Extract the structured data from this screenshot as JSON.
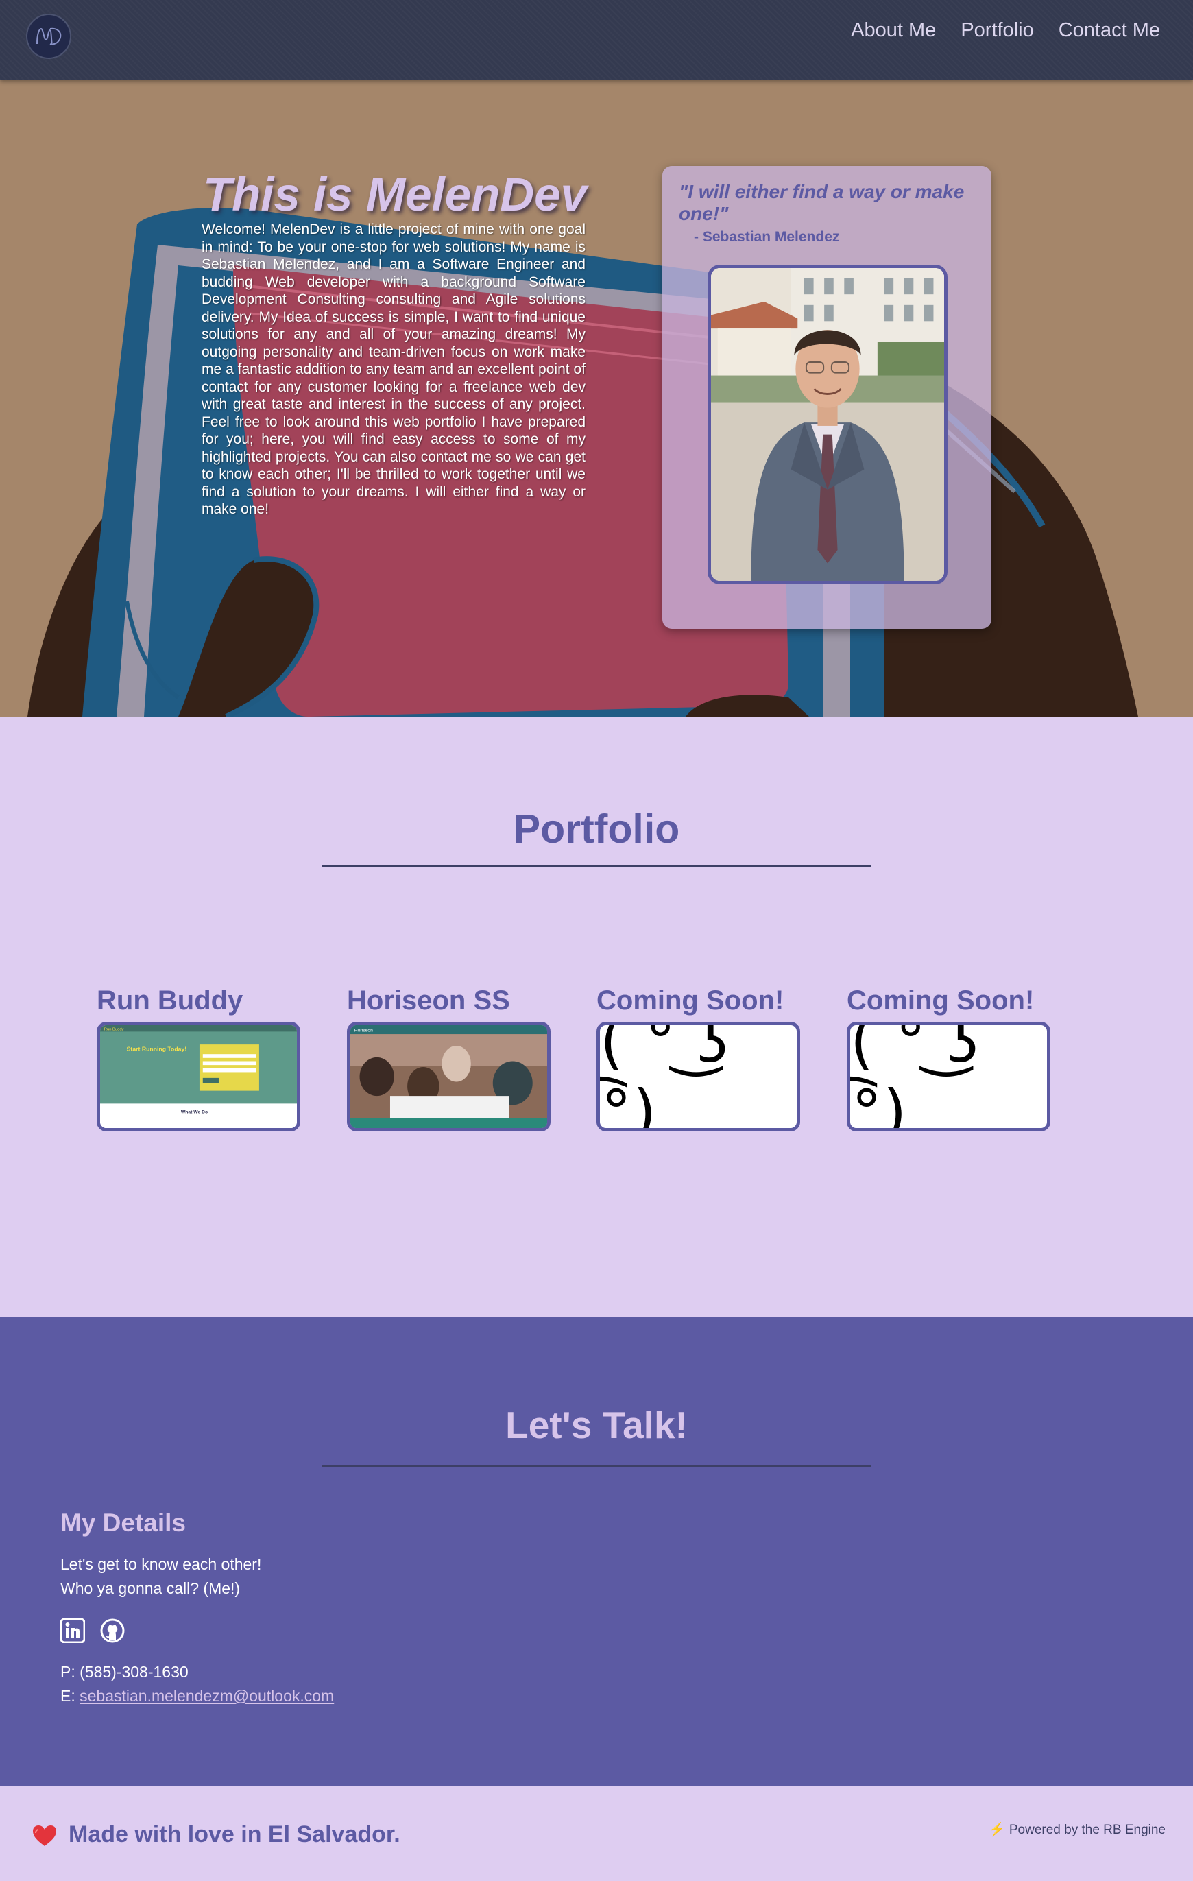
{
  "header": {
    "logo_text": "MD",
    "nav": [
      "About Me",
      "Portfolio",
      "Contact Me"
    ]
  },
  "hero": {
    "title": "This is MelenDev",
    "intro": "Welcome! MelenDev is a little project of mine with one goal in mind: To be your one-stop for web solutions! My name is Sebastian Melendez, and I am a Software Engineer and budding Web developer with a background Software Development Consulting consulting and Agile solutions delivery. My Idea of success is simple, I want to find unique solutions for any and all of your amazing dreams! My outgoing personality and team-driven focus on work make me a fantastic addition to any team and an excellent point of contact for any customer looking for a freelance web dev with great taste and interest in the success of any project. Feel free to look around this web portfolio I have prepared for you; here, you will find easy access to some of my highlighted projects. You can also contact me so we can get to know each other; I'll be thrilled to work together until we find a solution to your dreams. I will either find a way or make one!",
    "quote": "\"I will either find a way or make one!\"",
    "quote_author": "- Sebastian Melendez"
  },
  "portfolio": {
    "title": "Portfolio",
    "projects": [
      {
        "title": "Run Buddy",
        "thumb": "run-buddy-screenshot"
      },
      {
        "title": "Horiseon SS",
        "thumb": "horiseon-screenshot"
      },
      {
        "title": "Coming Soon!",
        "thumb": "( ͡° ͜ʖ ͡°)"
      },
      {
        "title": "Coming Soon!",
        "thumb": "( ͡° ͜ʖ ͡°)"
      }
    ],
    "run_buddy_thumb_text": {
      "headline": "Start Running Today!",
      "section": "What We Do",
      "brand": "Run Buddy"
    },
    "horiseon_thumb_text": {
      "brand": "Horiseon"
    }
  },
  "contact": {
    "title": "Let's Talk!",
    "details_title": "My Details",
    "lines": [
      "Let's get to know each other!",
      "Who ya gonna call? (Me!)"
    ],
    "phone": "P: (585)-308-1630",
    "email_label": "E: ",
    "email": "sebastian.melendezm@outlook.com",
    "social": [
      "linkedin-icon",
      "github-icon"
    ]
  },
  "footer": {
    "made_with": "Made with love in El Salvador.",
    "powered": "Powered by the RB Engine"
  },
  "colors": {
    "header": "#343a50",
    "accent": "#5c5aa3",
    "light_purple": "#decdf1",
    "hero_bg": "#a5866a"
  }
}
